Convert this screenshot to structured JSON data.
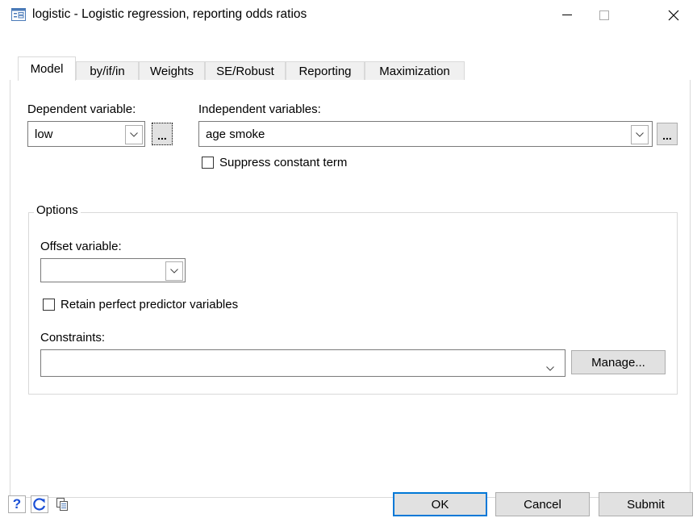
{
  "window": {
    "title": "logistic - Logistic regression, reporting odds ratios",
    "icon": "dialog-icon",
    "controls": [
      "minimize-icon",
      "maximize-icon",
      "close-icon"
    ]
  },
  "tabs": [
    {
      "label": "Model",
      "active": true
    },
    {
      "label": "by/if/in"
    },
    {
      "label": "Weights"
    },
    {
      "label": "SE/Robust"
    },
    {
      "label": "Reporting"
    },
    {
      "label": "Maximization"
    }
  ],
  "model": {
    "dependent_label": "Dependent variable:",
    "dependent_value": "low",
    "independent_label": "Independent variables:",
    "independent_value": "age smoke",
    "ellipsis": "...",
    "suppress_label": "Suppress constant term",
    "suppress_checked": false
  },
  "options": {
    "legend": "Options",
    "offset_label": "Offset variable:",
    "offset_value": "",
    "retain_label": "Retain perfect predictor variables",
    "retain_checked": false,
    "constraints_label": "Constraints:",
    "constraints_value": "",
    "manage_label": "Manage..."
  },
  "footer": {
    "help": "?",
    "buttons": {
      "ok": "OK",
      "cancel": "Cancel",
      "submit": "Submit"
    },
    "icons": [
      "help-icon",
      "reset-icon",
      "copy-icon"
    ]
  },
  "colors": {
    "focus_border": "#0078d7",
    "help_blue": "#1a4fd6"
  }
}
